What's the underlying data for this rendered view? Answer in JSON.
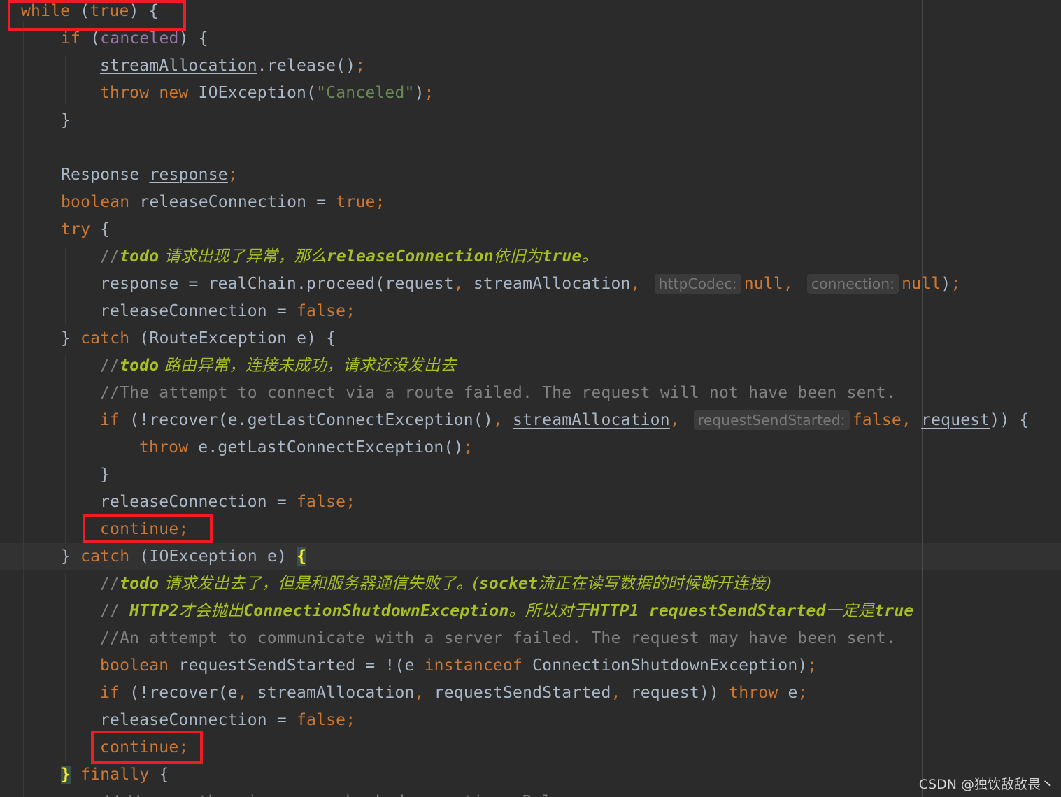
{
  "code_lines": [
    {
      "tokens": [
        {
          "t": "while",
          "c": "kw"
        },
        {
          "t": " (",
          "c": "p"
        },
        {
          "t": "true",
          "c": "kw"
        },
        {
          "t": ") {",
          "c": "p"
        }
      ]
    },
    {
      "tokens": [
        {
          "t": "if",
          "c": "kw"
        },
        {
          "t": " (",
          "c": "p"
        },
        {
          "t": "canceled",
          "c": "field"
        },
        {
          "t": ") {",
          "c": "p"
        }
      ]
    },
    {
      "tokens": [
        {
          "t": "streamAllocation",
          "c": "id u"
        },
        {
          "t": ".release()",
          "c": "p"
        },
        {
          "t": ";",
          "c": "semi"
        }
      ]
    },
    {
      "tokens": [
        {
          "t": "throw",
          "c": "kw"
        },
        {
          "t": " ",
          "c": "p"
        },
        {
          "t": "new",
          "c": "kw"
        },
        {
          "t": " IOException(",
          "c": "p"
        },
        {
          "t": "\"Canceled\"",
          "c": "str"
        },
        {
          "t": ")",
          "c": "p"
        },
        {
          "t": ";",
          "c": "semi"
        }
      ]
    },
    {
      "tokens": [
        {
          "t": "}",
          "c": "p"
        }
      ]
    },
    {
      "tokens": []
    },
    {
      "tokens": [
        {
          "t": "Response ",
          "c": "p"
        },
        {
          "t": "response",
          "c": "id u"
        },
        {
          "t": ";",
          "c": "semi"
        }
      ]
    },
    {
      "tokens": [
        {
          "t": "boolean",
          "c": "kw"
        },
        {
          "t": " ",
          "c": "p"
        },
        {
          "t": "releaseConnection",
          "c": "id u"
        },
        {
          "t": " = ",
          "c": "p"
        },
        {
          "t": "true",
          "c": "kw"
        },
        {
          "t": ";",
          "c": "semi"
        }
      ]
    },
    {
      "tokens": [
        {
          "t": "try",
          "c": "kw"
        },
        {
          "t": " {",
          "c": "p"
        }
      ]
    },
    {
      "tokens": [
        {
          "t": "//",
          "c": "cm"
        },
        {
          "t": "todo",
          "c": "todo"
        },
        {
          "t": " 请求出现了异常，那么",
          "c": "cmi"
        },
        {
          "t": "releaseConnection",
          "c": "todo"
        },
        {
          "t": "依旧为",
          "c": "cmi"
        },
        {
          "t": "true",
          "c": "todo"
        },
        {
          "t": "。",
          "c": "cmi"
        }
      ]
    },
    {
      "tokens": [
        {
          "t": "response",
          "c": "id u"
        },
        {
          "t": " = realChain.proceed(",
          "c": "p"
        },
        {
          "t": "request",
          "c": "id u"
        },
        {
          "t": ", ",
          "c": "semi"
        },
        {
          "t": "streamAllocation",
          "c": "id u"
        },
        {
          "t": ", ",
          "c": "semi"
        },
        {
          "t": "httpCodec:",
          "c": "hint"
        },
        {
          "t": "null",
          "c": "kw"
        },
        {
          "t": ", ",
          "c": "semi"
        },
        {
          "t": "connection:",
          "c": "hint"
        },
        {
          "t": "null",
          "c": "kw"
        },
        {
          "t": ")",
          "c": "p"
        },
        {
          "t": ";",
          "c": "semi"
        }
      ]
    },
    {
      "tokens": [
        {
          "t": "releaseConnection",
          "c": "id u"
        },
        {
          "t": " = ",
          "c": "p"
        },
        {
          "t": "false",
          "c": "kw"
        },
        {
          "t": ";",
          "c": "semi"
        }
      ]
    },
    {
      "tokens": [
        {
          "t": "} ",
          "c": "p"
        },
        {
          "t": "catch",
          "c": "kw"
        },
        {
          "t": " (RouteException e) {",
          "c": "p"
        }
      ]
    },
    {
      "tokens": [
        {
          "t": "//",
          "c": "cm"
        },
        {
          "t": "todo",
          "c": "todo"
        },
        {
          "t": " 路由异常，连接未成功，请求还没发出去",
          "c": "cmi"
        }
      ]
    },
    {
      "tokens": [
        {
          "t": "//The attempt to connect via a route failed. The request will not have been sent.",
          "c": "cm"
        }
      ]
    },
    {
      "tokens": [
        {
          "t": "if",
          "c": "kw"
        },
        {
          "t": " (!recover(e.getLastConnectException()",
          "c": "p"
        },
        {
          "t": ", ",
          "c": "semi"
        },
        {
          "t": "streamAllocation",
          "c": "id u"
        },
        {
          "t": ", ",
          "c": "semi"
        },
        {
          "t": "requestSendStarted:",
          "c": "hint"
        },
        {
          "t": "false",
          "c": "kw"
        },
        {
          "t": ", ",
          "c": "semi"
        },
        {
          "t": "request",
          "c": "id u"
        },
        {
          "t": ")) {",
          "c": "p"
        }
      ]
    },
    {
      "tokens": [
        {
          "t": "throw",
          "c": "kw"
        },
        {
          "t": " e.getLastConnectException()",
          "c": "p"
        },
        {
          "t": ";",
          "c": "semi"
        }
      ]
    },
    {
      "tokens": [
        {
          "t": "}",
          "c": "p"
        }
      ]
    },
    {
      "tokens": [
        {
          "t": "releaseConnection",
          "c": "id u"
        },
        {
          "t": " = ",
          "c": "p"
        },
        {
          "t": "false",
          "c": "kw"
        },
        {
          "t": ";",
          "c": "semi"
        }
      ]
    },
    {
      "tokens": [
        {
          "t": "continue",
          "c": "kw"
        },
        {
          "t": ";",
          "c": "semi"
        }
      ]
    },
    {
      "tokens": [
        {
          "t": "} ",
          "c": "p"
        },
        {
          "t": "catch",
          "c": "kw"
        },
        {
          "t": " (IOException e) ",
          "c": "p"
        },
        {
          "t": "{",
          "c": "brace-hl"
        }
      ]
    },
    {
      "tokens": [
        {
          "t": "//",
          "c": "cm"
        },
        {
          "t": "todo",
          "c": "todo"
        },
        {
          "t": " 请求发出去了，但是和服务器通信失败了。(",
          "c": "cmi"
        },
        {
          "t": "socket",
          "c": "todo"
        },
        {
          "t": "流正在读写数据的时候断开连接)",
          "c": "cmi"
        }
      ]
    },
    {
      "tokens": [
        {
          "t": "// ",
          "c": "cm"
        },
        {
          "t": "HTTP2",
          "c": "todo"
        },
        {
          "t": "才会抛出",
          "c": "cmi"
        },
        {
          "t": "ConnectionShutdownException",
          "c": "todo"
        },
        {
          "t": "。所以对于",
          "c": "cmi"
        },
        {
          "t": "HTTP1 requestSendStarted",
          "c": "todo"
        },
        {
          "t": "一定是",
          "c": "cmi"
        },
        {
          "t": "true",
          "c": "todo"
        }
      ]
    },
    {
      "tokens": [
        {
          "t": "//An attempt to communicate with a server failed. The request may have been sent.",
          "c": "cm"
        }
      ]
    },
    {
      "tokens": [
        {
          "t": "boolean",
          "c": "kw"
        },
        {
          "t": " requestSendStarted = !(e ",
          "c": "p"
        },
        {
          "t": "instanceof",
          "c": "kw"
        },
        {
          "t": " ConnectionShutdownException)",
          "c": "p"
        },
        {
          "t": ";",
          "c": "semi"
        }
      ]
    },
    {
      "tokens": [
        {
          "t": "if",
          "c": "kw"
        },
        {
          "t": " (!recover(e",
          "c": "p"
        },
        {
          "t": ", ",
          "c": "semi"
        },
        {
          "t": "streamAllocation",
          "c": "id u"
        },
        {
          "t": ", ",
          "c": "semi"
        },
        {
          "t": "requestSendStarted",
          "c": "p"
        },
        {
          "t": ", ",
          "c": "semi"
        },
        {
          "t": "request",
          "c": "id u"
        },
        {
          "t": ")) ",
          "c": "p"
        },
        {
          "t": "throw",
          "c": "kw"
        },
        {
          "t": " e",
          "c": "p"
        },
        {
          "t": ";",
          "c": "semi"
        }
      ]
    },
    {
      "tokens": [
        {
          "t": "releaseConnection",
          "c": "id u"
        },
        {
          "t": " = ",
          "c": "p"
        },
        {
          "t": "false",
          "c": "kw"
        },
        {
          "t": ";",
          "c": "semi"
        }
      ]
    },
    {
      "tokens": [
        {
          "t": "continue",
          "c": "kw"
        },
        {
          "t": ";",
          "c": "semi"
        }
      ]
    },
    {
      "tokens": [
        {
          "t": "}",
          "c": "brace-hl"
        },
        {
          "t": " ",
          "c": "p"
        },
        {
          "t": "finally",
          "c": "kw"
        },
        {
          "t": " {",
          "c": "p"
        }
      ]
    },
    {
      "tokens": [
        {
          "t": "// We are throwing an unchecked exception. Release",
          "c": "cm"
        }
      ]
    }
  ],
  "watermark": "CSDN @独饮敌敌畏丶",
  "colors": {
    "background": "#2b2b2b",
    "keyword": "#cc7832",
    "identifier": "#a9b7c6",
    "string": "#6a8759",
    "field": "#9876aa",
    "comment": "#808080",
    "todo": "#a8c023",
    "highlight_box": "#ee1c24"
  }
}
